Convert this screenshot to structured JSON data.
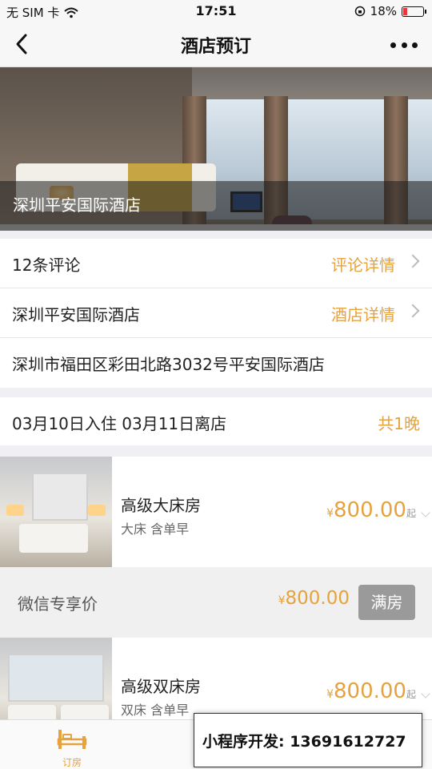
{
  "status_bar": {
    "carrier": "无 SIM 卡",
    "time": "17:51",
    "battery": "18%",
    "battery_level": 0.18
  },
  "nav": {
    "title": "酒店预订"
  },
  "hero": {
    "caption": "深圳平安国际酒店"
  },
  "info": {
    "reviews_label": "12条评论",
    "reviews_link": "评论详情",
    "hotel_label": "深圳平安国际酒店",
    "hotel_link": "酒店详情",
    "address": "深圳市福田区彩田北路3032号平安国际酒店"
  },
  "dates": {
    "label": "03月10日入住 03月11日离店",
    "nights": "共1晚"
  },
  "rooms": [
    {
      "name": "高级大床房",
      "desc": "大床 含单早",
      "currency": "¥",
      "price": "800.00",
      "from": "起"
    },
    {
      "name": "高级双床房",
      "desc": "双床 含单早",
      "currency": "¥",
      "price": "800.00",
      "from": "起"
    }
  ],
  "wechat": {
    "label": "微信专享价",
    "currency": "¥",
    "price": "800.00",
    "button": "满房"
  },
  "tabbar": {
    "items": [
      {
        "label": "订房"
      }
    ]
  },
  "promo": {
    "text": "小程序开发: 13691612727"
  },
  "colors": {
    "accent": "#e6a23c",
    "button_gray": "#9a9a9a"
  }
}
